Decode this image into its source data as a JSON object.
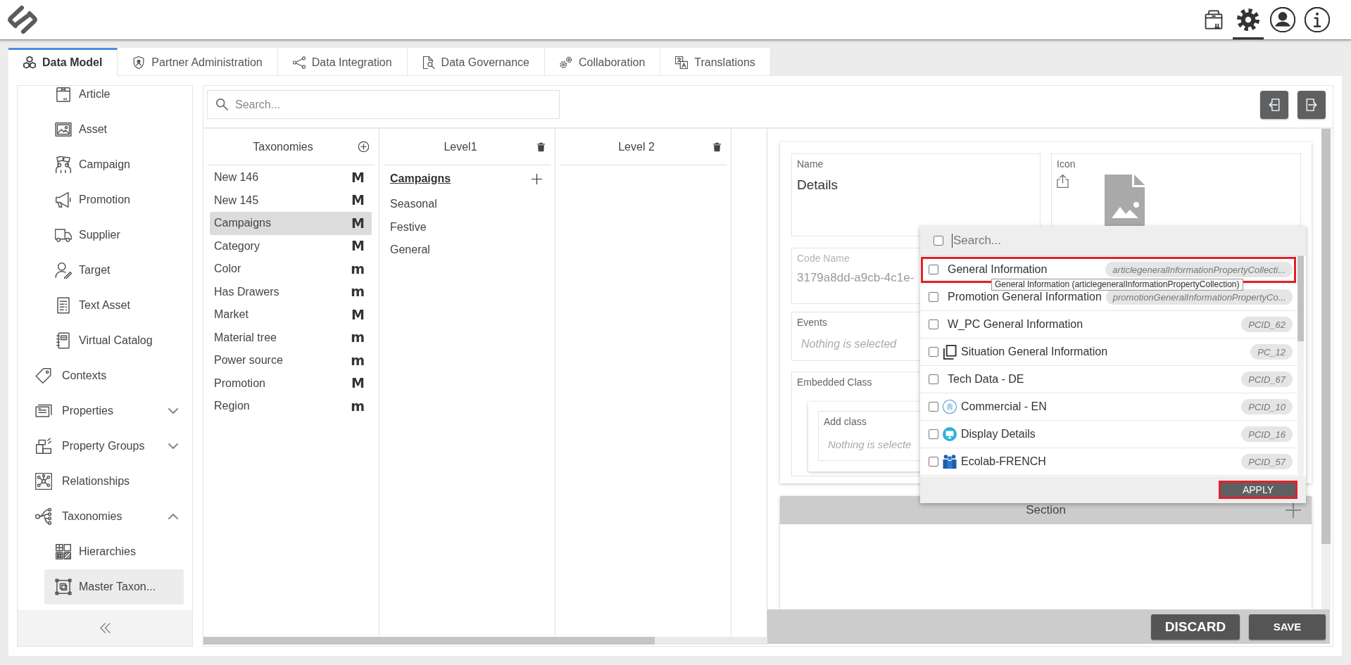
{
  "top_bar": {
    "buttons": [
      {
        "kind": "package",
        "selected": false
      },
      {
        "kind": "settings",
        "selected": true
      },
      {
        "kind": "user",
        "selected": false
      },
      {
        "kind": "info",
        "selected": false
      }
    ]
  },
  "tabs": [
    {
      "label": "Data Model",
      "selected": true
    },
    {
      "label": "Partner Administration",
      "selected": false
    },
    {
      "label": "Data Integration",
      "selected": false
    },
    {
      "label": "Data Governance",
      "selected": false
    },
    {
      "label": "Collaboration",
      "selected": false
    },
    {
      "label": "Translations",
      "selected": false
    }
  ],
  "sidebar": {
    "items": [
      {
        "children": [
          {
            "label": "Article",
            "selected": false
          },
          {
            "label": "Asset",
            "selected": false
          },
          {
            "label": "Campaign",
            "selected": false
          },
          {
            "label": "Promotion",
            "selected": false
          },
          {
            "label": "Supplier",
            "selected": false
          },
          {
            "label": "Target",
            "selected": false
          },
          {
            "label": "Text Asset",
            "selected": false
          },
          {
            "label": "Virtual Catalog",
            "selected": false
          }
        ]
      },
      {
        "label": "Contexts",
        "selected": false
      },
      {
        "label": "Properties",
        "selected": false,
        "expanded": false
      },
      {
        "label": "Property Groups",
        "selected": false,
        "expanded": false
      },
      {
        "label": "Relationships",
        "selected": false
      },
      {
        "label": "Taxonomies",
        "selected": false,
        "expanded": true,
        "children": [
          {
            "label": "Hierarchies",
            "selected": false
          },
          {
            "label": "Master Taxon...",
            "selected": true
          }
        ]
      }
    ]
  },
  "search": {
    "placeholder": "Search..."
  },
  "columns": [
    {
      "kind": "root",
      "title": "Taxonomies",
      "items": [
        {
          "label": "New 146",
          "badge": "M",
          "selected": false
        },
        {
          "label": "New 145",
          "badge": "M",
          "selected": false
        },
        {
          "label": "Campaigns",
          "badge": "M",
          "selected": true
        },
        {
          "label": "Category",
          "badge": "M",
          "selected": false
        },
        {
          "label": "Color",
          "badge": "m",
          "selected": false
        },
        {
          "label": "Has Drawers",
          "badge": "m",
          "selected": false
        },
        {
          "label": "Market",
          "badge": "M",
          "selected": false
        },
        {
          "label": "Material tree",
          "badge": "m",
          "selected": false
        },
        {
          "label": "Power source",
          "badge": "m",
          "selected": false
        },
        {
          "label": "Promotion",
          "badge": "M",
          "selected": false
        },
        {
          "label": "Region",
          "badge": "m",
          "selected": false
        }
      ]
    },
    {
      "kind": "level",
      "title": "Level1",
      "parent": "Campaigns",
      "items": [
        {
          "label": "Seasonal",
          "selected": false
        },
        {
          "label": "Festive",
          "selected": false
        },
        {
          "label": "General",
          "selected": false
        }
      ]
    },
    {
      "kind": "level",
      "title": "Level 2"
    }
  ],
  "details": {
    "name": {
      "label": "Name",
      "value": "Details"
    },
    "icon": {
      "label": "Icon"
    },
    "code_name": {
      "label": "Code Name",
      "value": "3179a8dd-a9cb-4c1e-",
      "disabled": true
    },
    "events": {
      "label": "Events",
      "placeholder": "Nothing is selected"
    },
    "embedded_class": {
      "label": "Embedded Class",
      "add_class": {
        "label": "Add class",
        "placeholder": "Nothing is selecte"
      }
    },
    "section": {
      "title": "Section"
    }
  },
  "picker": {
    "select_all": {
      "checked": false
    },
    "search": {
      "placeholder": "Search..."
    },
    "options": [
      {
        "label": "General Information",
        "code": "articlegeneralInformationPropertyCollecti...",
        "checked": false,
        "highlighted": true
      },
      {
        "label": "Promotion General Information",
        "code": "promotionGeneralInformationPropertyCo...",
        "checked": false,
        "highlighted": false
      },
      {
        "label": "W_PC General Information",
        "code": "PCID_62",
        "checked": false,
        "highlighted": false
      },
      {
        "label": "Situation General Information",
        "code": "PC_12",
        "checked": false,
        "highlighted": false
      },
      {
        "label": "Tech Data - DE",
        "code": "PCID_67",
        "checked": false,
        "highlighted": false
      },
      {
        "label": "Commercial - EN",
        "code": "PCID_10",
        "checked": false,
        "highlighted": false
      },
      {
        "label": "Display Details",
        "code": "PCID_16",
        "checked": false,
        "highlighted": false
      },
      {
        "label": "Ecolab-FRENCH",
        "code": "PCID_57",
        "checked": false,
        "highlighted": false
      }
    ],
    "tooltip": "General Information (articlegeneralInformationPropertyCollection)",
    "apply": {
      "label": "APPLY",
      "highlighted": true
    }
  },
  "footer": {
    "buttons": [
      {
        "label": "DISCARD",
        "kind": "discard"
      },
      {
        "label": "SAVE",
        "kind": "save"
      }
    ]
  }
}
